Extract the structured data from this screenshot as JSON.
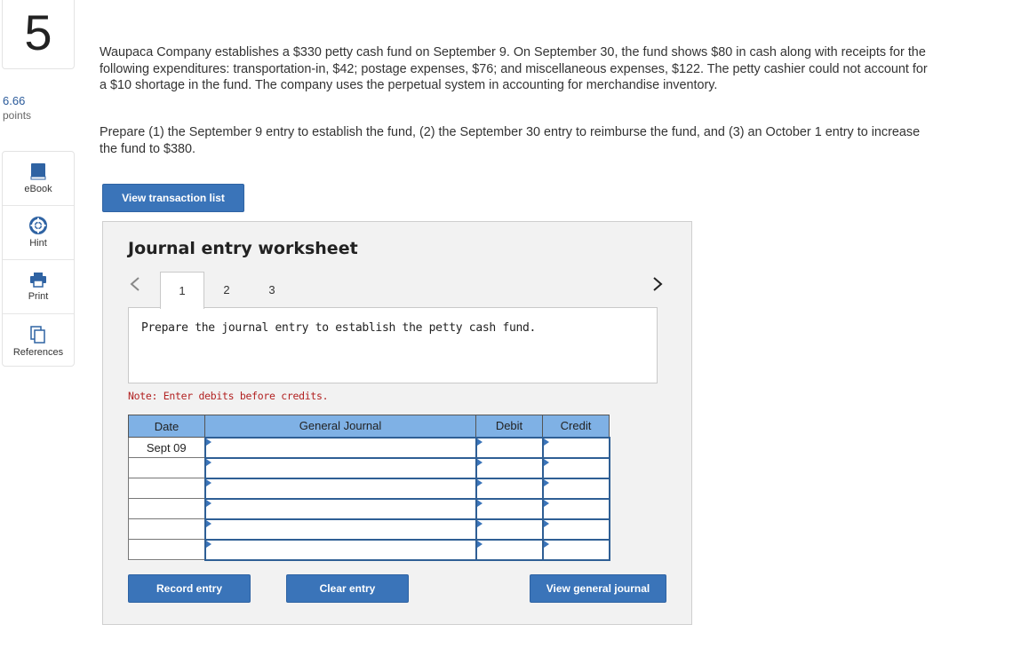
{
  "question": {
    "number": "5",
    "points_value": "6.66",
    "points_label": "points"
  },
  "tools": [
    {
      "label": "eBook",
      "icon": "book-icon"
    },
    {
      "label": "Hint",
      "icon": "lifebuoy-icon"
    },
    {
      "label": "Print",
      "icon": "printer-icon"
    },
    {
      "label": "References",
      "icon": "copy-icon"
    }
  ],
  "problem_text": "Waupaca Company establishes a $330 petty cash fund on September 9. On September 30, the fund shows $80 in cash along with receipts for the following expenditures: transportation-in, $42; postage expenses, $76; and miscellaneous expenses, $122. The petty cashier could not account for a $10 shortage in the fund. The company uses the perpetual system in accounting for merchandise inventory.",
  "instructions_text": "Prepare (1) the September 9 entry to establish the fund, (2) the September 30 entry to reimburse the fund, and (3) an October 1 entry to increase the fund to $380.",
  "buttons": {
    "view_transaction_list": "View transaction list",
    "record_entry": "Record entry",
    "clear_entry": "Clear entry",
    "view_general_journal": "View general journal"
  },
  "worksheet": {
    "title": "Journal entry worksheet",
    "tabs": [
      "1",
      "2",
      "3"
    ],
    "active_tab": "1",
    "prompt": "Prepare the journal entry to establish the petty cash fund.",
    "note": "Note: Enter debits before credits.",
    "columns": [
      "Date",
      "General Journal",
      "Debit",
      "Credit"
    ],
    "rows": [
      {
        "date": "Sept 09",
        "account": "",
        "debit": "",
        "credit": ""
      },
      {
        "date": "",
        "account": "",
        "debit": "",
        "credit": ""
      },
      {
        "date": "",
        "account": "",
        "debit": "",
        "credit": ""
      },
      {
        "date": "",
        "account": "",
        "debit": "",
        "credit": ""
      },
      {
        "date": "",
        "account": "",
        "debit": "",
        "credit": ""
      },
      {
        "date": "",
        "account": "",
        "debit": "",
        "credit": ""
      }
    ]
  },
  "colors": {
    "button_blue": "#3a74b9",
    "header_blue": "#7fb1e5",
    "note_red": "#b22222"
  }
}
